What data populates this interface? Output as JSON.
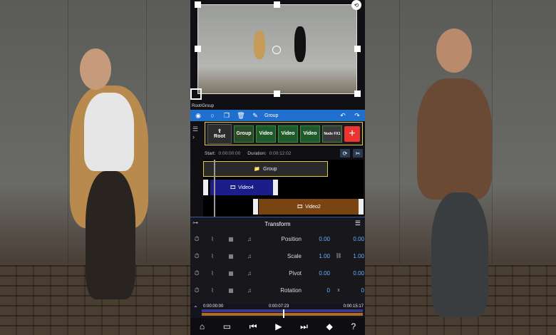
{
  "breadcrumb": "Root/Group",
  "toolbar": {
    "icons": [
      "eye-icon",
      "circle-icon",
      "copy-icon",
      "trash-icon",
      "pencil-icon",
      "undo-icon",
      "redo-icon"
    ],
    "group_label": "Group"
  },
  "layers": {
    "root_label": "Root",
    "chips": [
      "Group",
      "Video",
      "Video",
      "Video",
      "Node FX1"
    ],
    "add_symbol": "+"
  },
  "timing": {
    "start_label": "Start:",
    "start_value": "0:00:00:00",
    "duration_label": "Duration:",
    "duration_value": "0:00:12:02"
  },
  "tracks": {
    "group_label": "Group",
    "video4_label": "Video4",
    "video2_label": "Video2"
  },
  "transform": {
    "title": "Transform",
    "rows": [
      {
        "label": "Position",
        "v1": "0.00",
        "link": "",
        "v2": "0.00"
      },
      {
        "label": "Scale",
        "v1": "1.00",
        "link": "🔗",
        "v2": "1.00"
      },
      {
        "label": "Pivot",
        "v1": "0.00",
        "link": "",
        "v2": "0.00"
      },
      {
        "label": "Rotation",
        "v1": "0",
        "link": "x",
        "v2": "0"
      }
    ]
  },
  "scrubber": {
    "start": "0:00:00:00",
    "current": "0:00:07:23",
    "end": "0:00:15:17"
  },
  "colors": {
    "accent": "#1f6fcf",
    "value_blue": "#6ab0ff",
    "highlight_yellow": "#e6c74a",
    "add_red": "#e33333"
  }
}
